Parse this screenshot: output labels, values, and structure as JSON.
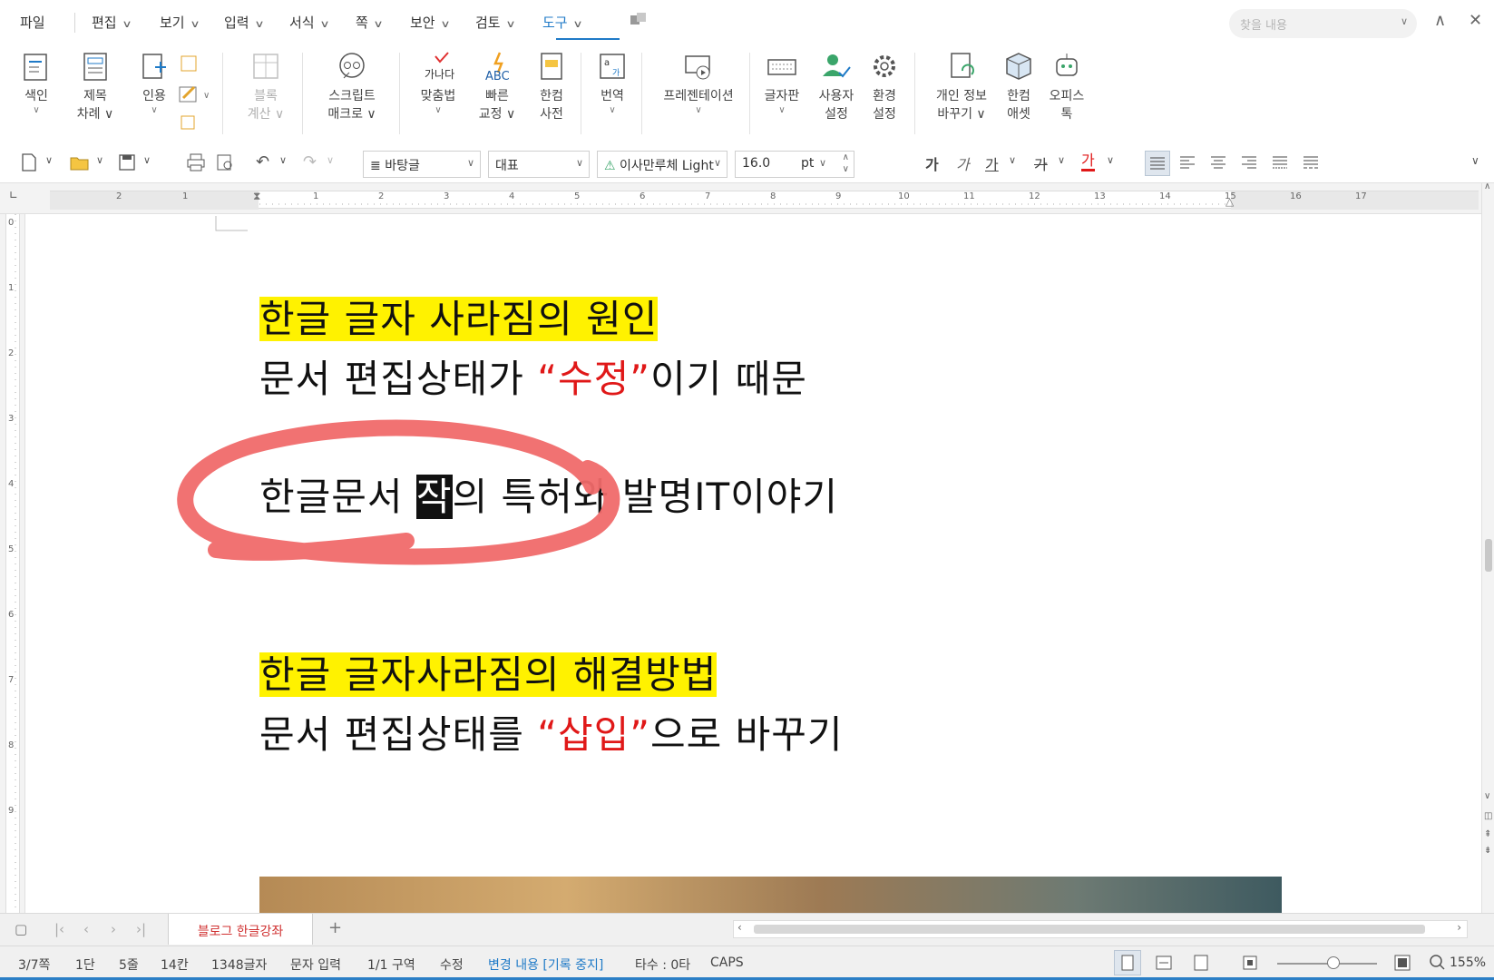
{
  "menu": {
    "items": [
      "파일",
      "편집",
      "보기",
      "입력",
      "서식",
      "쪽",
      "보안",
      "검토",
      "도구"
    ],
    "search_placeholder": "찾을 내용"
  },
  "ribbon": {
    "buttons": [
      {
        "label1": "색인",
        "label2": ""
      },
      {
        "label1": "제목",
        "label2": "차례"
      },
      {
        "label1": "인용",
        "label2": ""
      },
      {
        "label1": "블록",
        "label2": "계산"
      },
      {
        "label1": "스크립트",
        "label2": "매크로"
      },
      {
        "label1": "맞춤법",
        "label2": ""
      },
      {
        "label1": "빠른",
        "label2": "교정"
      },
      {
        "label1": "한컴",
        "label2": "사전"
      },
      {
        "label1": "번역",
        "label2": ""
      },
      {
        "label1": "프레젠테이션",
        "label2": ""
      },
      {
        "label1": "글자판",
        "label2": ""
      },
      {
        "label1": "사용자",
        "label2": "설정"
      },
      {
        "label1": "환경",
        "label2": "설정"
      },
      {
        "label1": "개인 정보",
        "label2": "바꾸기"
      },
      {
        "label1": "한컴",
        "label2": "애셋"
      },
      {
        "label1": "오피스",
        "label2": "톡"
      }
    ],
    "spellcheck_icon_text": "가나다",
    "quickfix_icon_text": "ABC"
  },
  "toolbar": {
    "style": "바탕글",
    "lang": "대표",
    "font": "이사만루체 Light",
    "size": "16.0",
    "unit": "pt",
    "fmt_glyphs": [
      "가",
      "가",
      "가",
      "가",
      "가"
    ]
  },
  "ruler": {
    "h_numbers": [
      "2",
      "1",
      "1",
      "2",
      "3",
      "4",
      "5",
      "6",
      "7",
      "8",
      "9",
      "10",
      "11",
      "12",
      "13",
      "14",
      "15",
      "16",
      "17"
    ],
    "v_numbers": [
      "0",
      "1",
      "2",
      "3",
      "4",
      "5",
      "6",
      "7",
      "8",
      "9"
    ]
  },
  "document": {
    "heading1": "한글 글자 사라짐의 원인",
    "line2_a": "문서 편집상태가 ",
    "line2_b": "“수정”",
    "line2_c": "이기 때문",
    "line3_a": "한글문서 ",
    "line3_b": "작",
    "line3_c": "의 특허와 발명IT이야기",
    "heading2": "한글 글자사라짐의 해결방법",
    "line5_a": "문서 편집상태를 ",
    "line5_b": "“삽입”",
    "line5_c": "으로 바꾸기"
  },
  "tabs": {
    "doc_tab": "블로그 한글강좌",
    "add": "+"
  },
  "status": {
    "page": "3/7쪽",
    "col": "1단",
    "line": "5줄",
    "char": "14칸",
    "count": "1348글자",
    "mode": "문자 입력",
    "section": "1/1 구역",
    "edit": "수정",
    "change": "변경 내용 [기록 중지]",
    "typing": "타수 : 0타",
    "caps": "CAPS",
    "zoom": "155%"
  },
  "colors": {
    "accent": "#1f7ac7",
    "highlight": "#fff200",
    "red_text": "#e01818",
    "annotation": "#f06060"
  }
}
